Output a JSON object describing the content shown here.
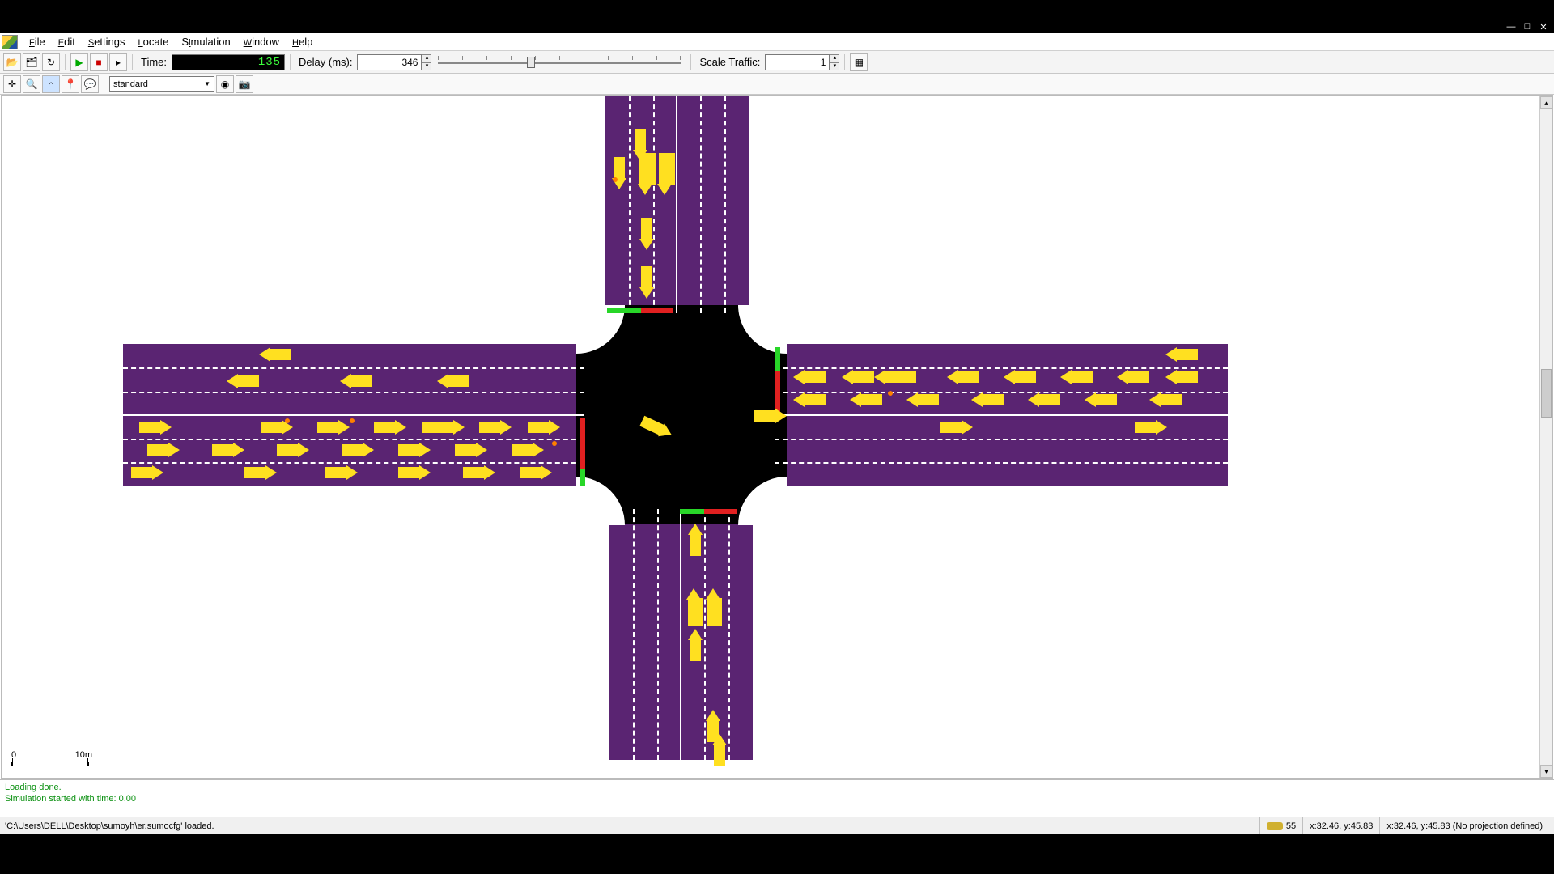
{
  "menu": {
    "file": "File",
    "edit": "Edit",
    "settings": "Settings",
    "locate": "Locate",
    "simulation": "Simulation",
    "window": "Window",
    "help": "Help"
  },
  "toolbar": {
    "time_label": "Time:",
    "time_value": "135",
    "delay_label": "Delay (ms):",
    "delay_value": "346",
    "scale_label": "Scale Traffic:",
    "scale_value": "1"
  },
  "view": {
    "scheme": "standard"
  },
  "scale": {
    "min": "0",
    "max": "10m"
  },
  "log": {
    "l1": "Loading done.",
    "l2": "Simulation started with time: 0.00"
  },
  "status": {
    "file": "'C:\\Users\\DELL\\Desktop\\sumoyh\\er.sumocfg' loaded.",
    "count": "55",
    "coord1": "x:32.46, y:45.83",
    "coord2": "x:32.46, y:45.83 (No projection defined)"
  }
}
